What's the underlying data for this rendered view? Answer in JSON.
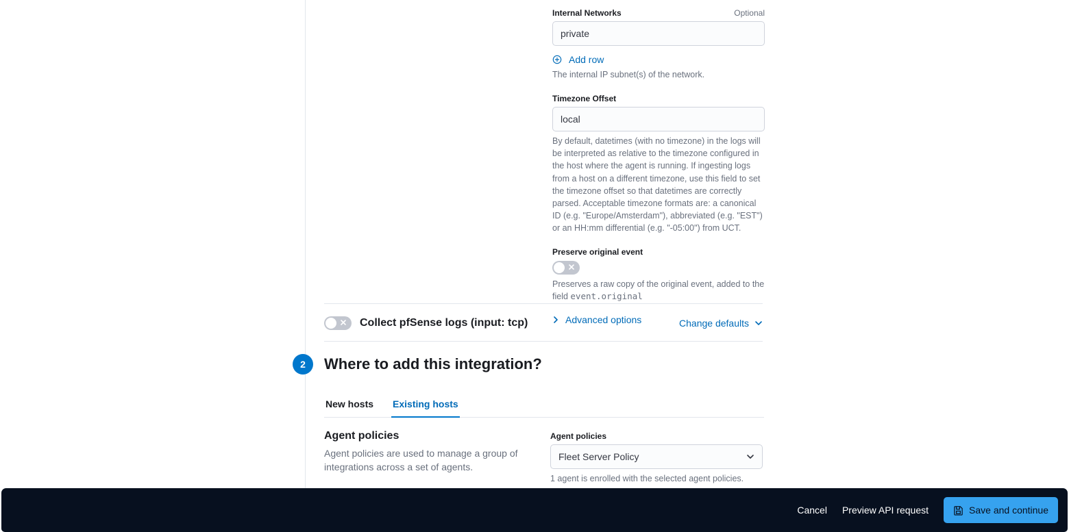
{
  "form": {
    "internal_networks": {
      "label": "Internal Networks",
      "optional": "Optional",
      "value": "private",
      "add_row_label": "Add row",
      "help": "The internal IP subnet(s) of the network."
    },
    "timezone_offset": {
      "label": "Timezone Offset",
      "value": "local",
      "help": "By default, datetimes (with no timezone) in the logs will be interpreted as relative to the timezone configured in the host where the agent is running. If ingesting logs from a host on a different timezone, use this field to set the timezone offset so that datetimes are correctly parsed. Acceptable timezone formats are: a canonical ID (e.g. \"Europe/Amsterdam\"), abbreviated (e.g. \"EST\") or an HH:mm differential (e.g. \"-05:00\") from UCT."
    },
    "preserve_event": {
      "label": "Preserve original event",
      "help_pre": "Preserves a raw copy of the original event, added to the field ",
      "help_code": "event.original"
    },
    "advanced_label": "Advanced options"
  },
  "tcp_input": {
    "label": "Collect pfSense logs (input: tcp)",
    "change_defaults": "Change defaults"
  },
  "section2": {
    "step": "2",
    "title": "Where to add this integration?",
    "tabs": [
      "New hosts",
      "Existing hosts"
    ],
    "left_h": "Agent policies",
    "left_p": "Agent policies are used to manage a group of integrations across a set of agents.",
    "right_label": "Agent policies",
    "select_value": "Fleet Server Policy",
    "help": "1 agent is enrolled with the selected agent policies."
  },
  "footer": {
    "cancel": "Cancel",
    "preview": "Preview API request",
    "save": "Save and continue"
  }
}
